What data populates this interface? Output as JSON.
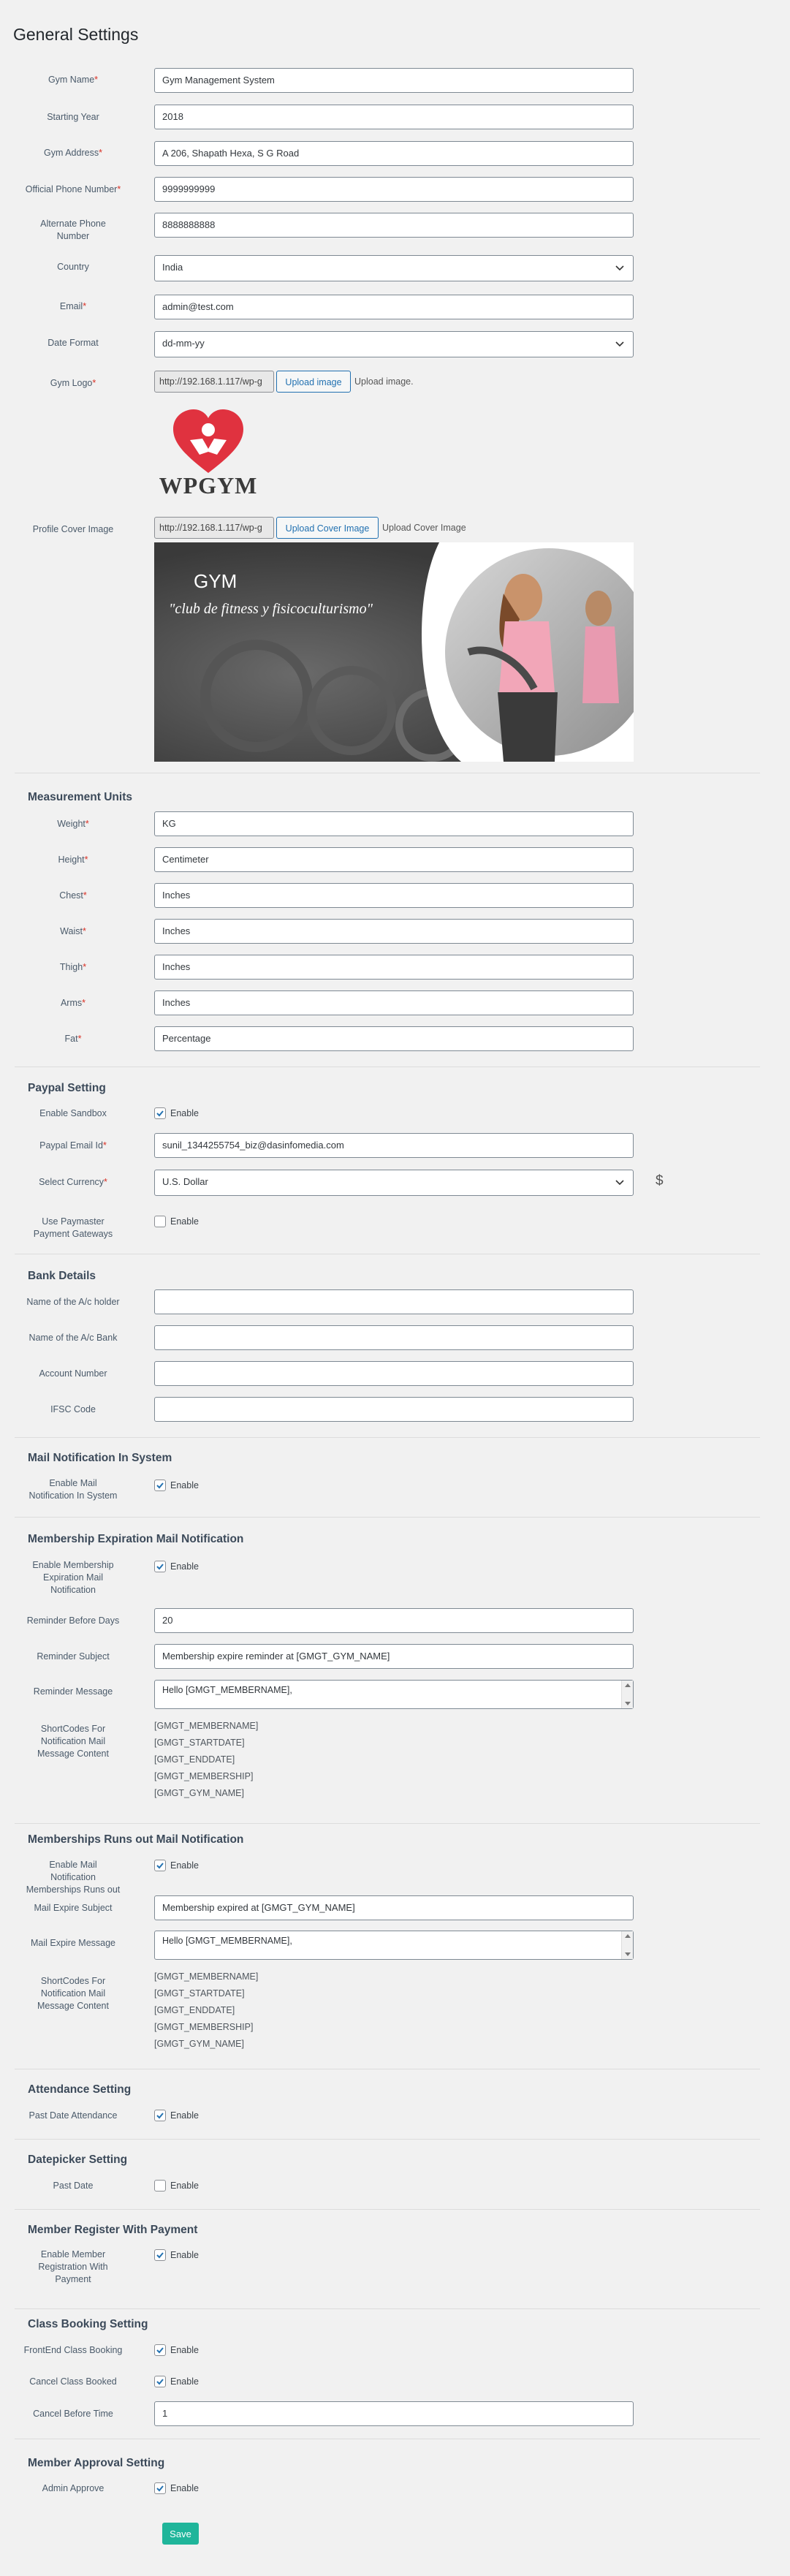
{
  "page": {
    "title": "General Settings"
  },
  "general": {
    "gym_name": {
      "label": "Gym Name",
      "value": "Gym Management System"
    },
    "starting_year": {
      "label": "Starting Year",
      "value": "2018"
    },
    "gym_address": {
      "label": "Gym Address",
      "value": "A 206, Shapath Hexa, S G Road"
    },
    "phone": {
      "label": "Official Phone Number",
      "value": "9999999999"
    },
    "alt_phone": {
      "label": "Alternate Phone Number",
      "value": "8888888888"
    },
    "country": {
      "label": "Country",
      "value": "India"
    },
    "email": {
      "label": "Email",
      "value": "admin@test.com"
    },
    "date_format": {
      "label": "Date Format",
      "value": "dd-mm-yy"
    },
    "gym_logo": {
      "label": "Gym Logo",
      "value": "http://192.168.1.117/wp-g",
      "button": "Upload image",
      "note": "Upload image.",
      "logo_text": "WPGYM"
    },
    "cover": {
      "label": "Profile Cover Image",
      "value": "http://192.168.1.117/wp-g",
      "button": "Upload Cover Image",
      "note": "Upload Cover Image",
      "img_title": "GYM",
      "img_tagline": "\"club de fitness y fisicoculturismo\""
    }
  },
  "measurement": {
    "title": "Measurement Units",
    "weight": {
      "label": "Weight",
      "value": "KG"
    },
    "height": {
      "label": "Height",
      "value": "Centimeter"
    },
    "chest": {
      "label": "Chest",
      "value": "Inches"
    },
    "waist": {
      "label": "Waist",
      "value": "Inches"
    },
    "thigh": {
      "label": "Thigh",
      "value": "Inches"
    },
    "arms": {
      "label": "Arms",
      "value": "Inches"
    },
    "fat": {
      "label": "Fat",
      "value": "Percentage"
    }
  },
  "paypal": {
    "title": "Paypal Setting",
    "sandbox": {
      "label": "Enable Sandbox",
      "check": "Enable",
      "checked": true
    },
    "email": {
      "label": "Paypal Email Id",
      "value": "sunil_1344255754_biz@dasinfomedia.com"
    },
    "currency": {
      "label": "Select Currency",
      "value": "U.S. Dollar",
      "symbol": "$"
    },
    "paymaster": {
      "label": "Use Paymaster Payment Gateways",
      "check": "Enable",
      "checked": false
    }
  },
  "bank": {
    "title": "Bank Details",
    "holder": {
      "label": "Name of the A/c holder",
      "value": ""
    },
    "bank": {
      "label": "Name of the A/c Bank",
      "value": ""
    },
    "account": {
      "label": "Account Number",
      "value": ""
    },
    "ifsc": {
      "label": "IFSC Code",
      "value": ""
    }
  },
  "mail_notify": {
    "title": "Mail Notification In System",
    "enable": {
      "label": "Enable Mail Notification In System",
      "check": "Enable",
      "checked": true
    }
  },
  "expiration": {
    "title": "Membership Expiration Mail Notification",
    "enable": {
      "label": "Enable Membership Expiration Mail Notification",
      "check": "Enable",
      "checked": true
    },
    "days": {
      "label": "Reminder Before Days",
      "value": "20"
    },
    "subject": {
      "label": "Reminder Subject",
      "value": "Membership expire reminder at [GMGT_GYM_NAME]"
    },
    "message": {
      "label": "Reminder Message",
      "value": "Hello [GMGT_MEMBERNAME],"
    },
    "shortcodes": {
      "label": "ShortCodes For Notification Mail Message Content",
      "items": [
        "[GMGT_MEMBERNAME]",
        "[GMGT_STARTDATE]",
        "[GMGT_ENDDATE]",
        "[GMGT_MEMBERSHIP]",
        "[GMGT_GYM_NAME]"
      ]
    }
  },
  "runsout": {
    "title": "Memberships Runs out Mail Notification",
    "enable": {
      "label": "Enable Mail Notification Memberships Runs out",
      "check": "Enable",
      "checked": true
    },
    "subject": {
      "label": "Mail Expire Subject",
      "value": "Membership expired at [GMGT_GYM_NAME]"
    },
    "message": {
      "label": "Mail Expire Message",
      "value": "Hello [GMGT_MEMBERNAME],"
    },
    "shortcodes": {
      "label": "ShortCodes For Notification Mail Message Content",
      "items": [
        "[GMGT_MEMBERNAME]",
        "[GMGT_STARTDATE]",
        "[GMGT_ENDDATE]",
        "[GMGT_MEMBERSHIP]",
        "[GMGT_GYM_NAME]"
      ]
    }
  },
  "attendance": {
    "title": "Attendance Setting",
    "past": {
      "label": "Past Date Attendance",
      "check": "Enable",
      "checked": true
    }
  },
  "datepicker": {
    "title": "Datepicker Setting",
    "past": {
      "label": "Past Date",
      "check": "Enable",
      "checked": false
    }
  },
  "register": {
    "title": "Member Register With Payment",
    "enable": {
      "label": "Enable Member Registration With Payment",
      "check": "Enable",
      "checked": true
    }
  },
  "booking": {
    "title": "Class Booking Setting",
    "frontend": {
      "label": "FrontEnd Class Booking",
      "check": "Enable",
      "checked": true
    },
    "cancel": {
      "label": "Cancel Class Booked",
      "check": "Enable",
      "checked": true
    },
    "before": {
      "label": "Cancel Before Time",
      "value": "1"
    }
  },
  "approval": {
    "title": "Member Approval Setting",
    "admin": {
      "label": "Admin Approve",
      "check": "Enable",
      "checked": true
    }
  },
  "actions": {
    "save_label": "Save"
  },
  "colors": {
    "save": "#1fb59a",
    "required": "#d93025",
    "link": "#2271b1",
    "logo_red": "#e0323f"
  }
}
